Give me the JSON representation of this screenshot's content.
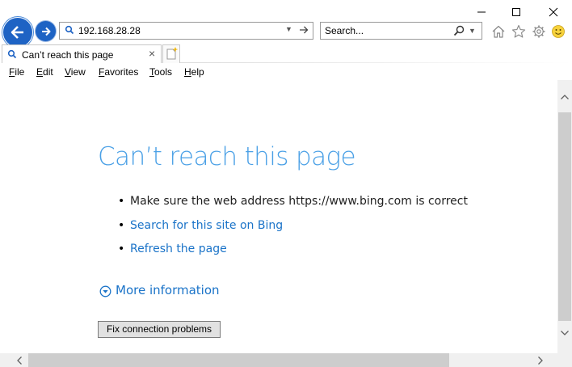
{
  "window": {
    "controls": [
      "minimize",
      "maximize",
      "close"
    ]
  },
  "toolbar": {
    "address_value": "192.168.28.28",
    "search_placeholder": "Search...",
    "icons": [
      "back-icon",
      "forward-icon",
      "home-icon",
      "favorites-star-icon",
      "settings-gear-icon",
      "smiley-feedback-icon"
    ]
  },
  "tabs": [
    {
      "title": "Can’t reach this page",
      "active": true
    }
  ],
  "menu": [
    "File",
    "Edit",
    "View",
    "Favorites",
    "Tools",
    "Help"
  ],
  "page": {
    "title": "Can’t reach this page",
    "bullets": [
      {
        "text": "Make sure the web address https://www.bing.com is correct",
        "link": false
      },
      {
        "text": "Search for this site on Bing",
        "link": true
      },
      {
        "text": "Refresh the page",
        "link": true
      }
    ],
    "more_info": "More information",
    "fix_button": "Fix connection problems"
  },
  "colors": {
    "accent_blue": "#1e63c4",
    "title_blue": "#4aa0e6",
    "link_blue": "#1a73c8",
    "button_gray": "#e1e1e1"
  }
}
